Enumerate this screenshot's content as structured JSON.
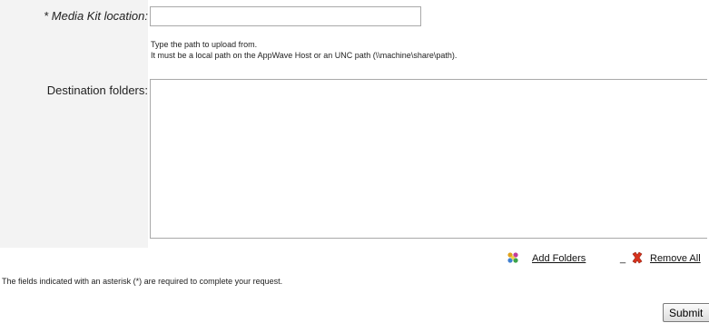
{
  "form": {
    "media_kit_label": "* Media Kit location:",
    "media_kit_value": "",
    "help_line_1": "Type the path to upload from.",
    "help_line_2": "It must be a local path on the AppWave Host or an UNC path (\\\\machine\\share\\path).",
    "destination_label": "Destination folders:",
    "destination_folders": []
  },
  "actions": {
    "add_folders_label": "Add Folders",
    "add_folders_icon": "add-folders-icon",
    "remove_all_label": "Remove All",
    "remove_all_icon": "red-x-icon",
    "remove_icon_color": "#d8321c"
  },
  "footnote": "The fields indicated with an asterisk (*) are required to complete your request.",
  "submit_label": "Submit"
}
